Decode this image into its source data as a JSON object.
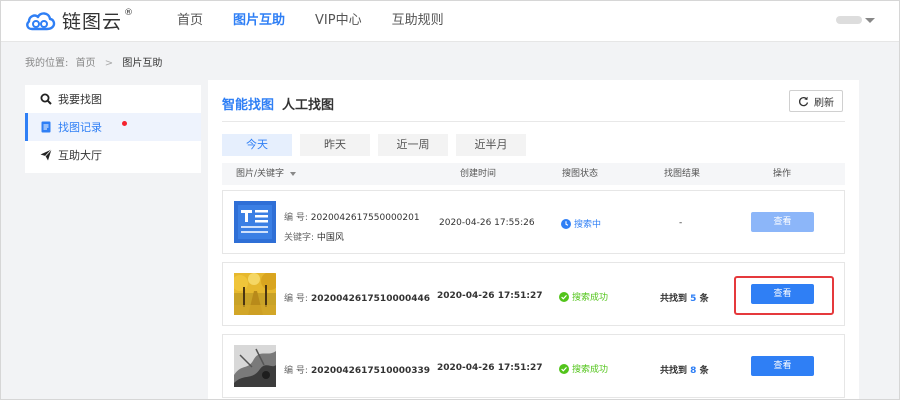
{
  "brand": {
    "name": "链图云",
    "registered": "®"
  },
  "nav": [
    {
      "label": "首页",
      "active": false
    },
    {
      "label": "图片互助",
      "active": true
    },
    {
      "label": "VIP中心",
      "active": false
    },
    {
      "label": "互助规则",
      "active": false
    }
  ],
  "breadcrumb": {
    "prefix": "我的位置:",
    "home": "首页",
    "separator": ">",
    "current": "图片互助"
  },
  "sidebar": {
    "items": [
      {
        "label": "我要找图",
        "icon": "search-icon",
        "active": false
      },
      {
        "label": "找图记录",
        "icon": "record-icon",
        "active": true,
        "badge": "red-dot"
      },
      {
        "label": "互助大厅",
        "icon": "send-icon",
        "active": false
      }
    ]
  },
  "tabs": [
    {
      "label": "智能找图",
      "active": true
    },
    {
      "label": "人工找图",
      "active": false
    }
  ],
  "refresh_label": "刷新",
  "filters": [
    {
      "label": "今天",
      "active": true
    },
    {
      "label": "昨天",
      "active": false
    },
    {
      "label": "近一周",
      "active": false
    },
    {
      "label": "近半月",
      "active": false
    }
  ],
  "table": {
    "headers": [
      "图片/关键字",
      "创建时间",
      "搜图状态",
      "找图结果",
      "操作"
    ],
    "rows": [
      {
        "code_label": "编  号:",
        "code": "2020042617550000201",
        "keyword_label": "关键字:",
        "keyword": "中国风",
        "time": "2020-04-26 17:55:26",
        "status": "搜索中",
        "status_type": "searching",
        "result": "-",
        "action": "查看",
        "action_disabled": true,
        "thumb": "text-document-image"
      },
      {
        "code_label": "编  号:",
        "code": "2020042617510000446",
        "time": "2020-04-26 17:51:27",
        "status": "搜索成功",
        "status_type": "success",
        "result_prefix": "共找到",
        "result_count": "5",
        "result_suffix": "条",
        "action": "查看",
        "action_disabled": false,
        "thumb": "autumn-trees-image"
      },
      {
        "code_label": "编  号:",
        "code": "2020042617510000339",
        "time": "2020-04-26 17:51:27",
        "status": "搜索成功",
        "status_type": "success",
        "result_prefix": "共找到",
        "result_count": "8",
        "result_suffix": "条",
        "action": "查看",
        "action_disabled": false,
        "thumb": "ink-painting-image"
      }
    ]
  },
  "colors": {
    "accent": "#2f7ff5",
    "success": "#52c41a",
    "highlight": "#e5393c"
  }
}
